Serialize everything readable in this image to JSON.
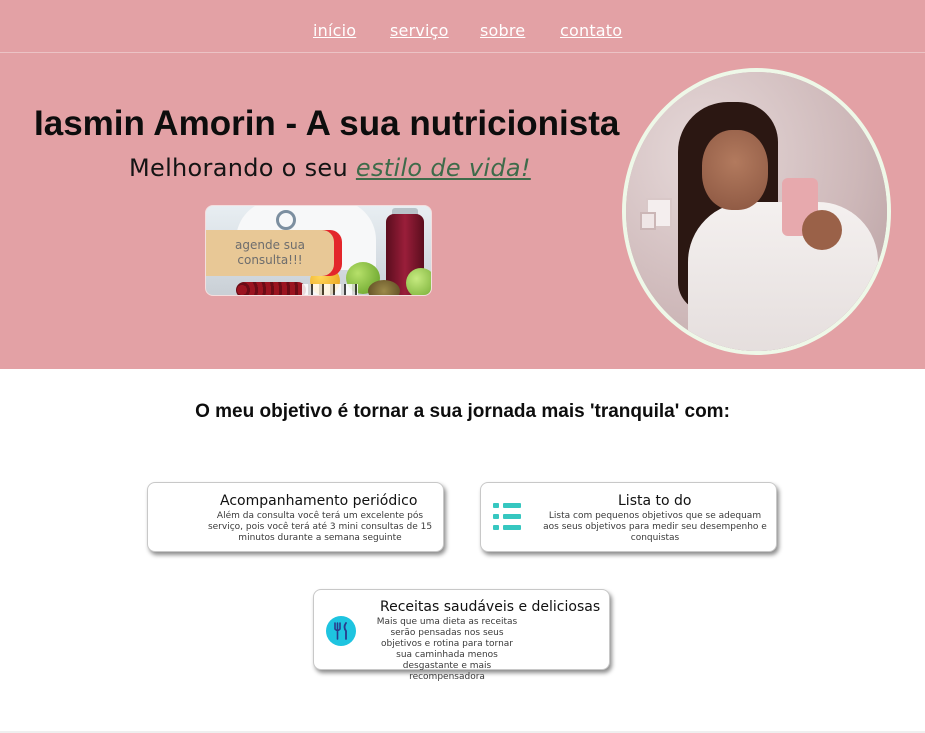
{
  "nav": {
    "items": [
      "início",
      "serviço",
      "sobre",
      "contato"
    ]
  },
  "hero": {
    "title": "Iasmin Amorin - A sua nutricionista",
    "subtitle_prefix": "Melhorando o seu ",
    "subtitle_emphasis": "estilo de vida!",
    "cta_label": "agende sua consulta!!!"
  },
  "section": {
    "title": "O meu objetivo é tornar a sua jornada mais 'tranquila' com:"
  },
  "cards": [
    {
      "title": "Acompanhamento periódico",
      "text": "Além da consulta você terá um excelente pós serviço, pois você terá até 3 mini consultas de 15 minutos durante a semana seguinte",
      "icon": "none"
    },
    {
      "title": "Lista to do",
      "text": "Lista com pequenos objetivos que se adequam aos seus objetivos para medir seu desempenho e conquistas",
      "icon": "list-icon"
    },
    {
      "title": "Receitas saudáveis e deliciosas",
      "text": "Mais que uma dieta as receitas serão pensadas nos seus objetivos e rotina para tornar sua caminhada menos desgastante e mais recompensadora",
      "icon": "fork-knife-icon"
    }
  ],
  "colors": {
    "hero_bg": "#e3a1a5",
    "accent_teal": "#36c7c0",
    "accent_cyan": "#1ec4e0",
    "emphasis_green": "#3e6b4a",
    "cta_box": "#e8c896"
  }
}
